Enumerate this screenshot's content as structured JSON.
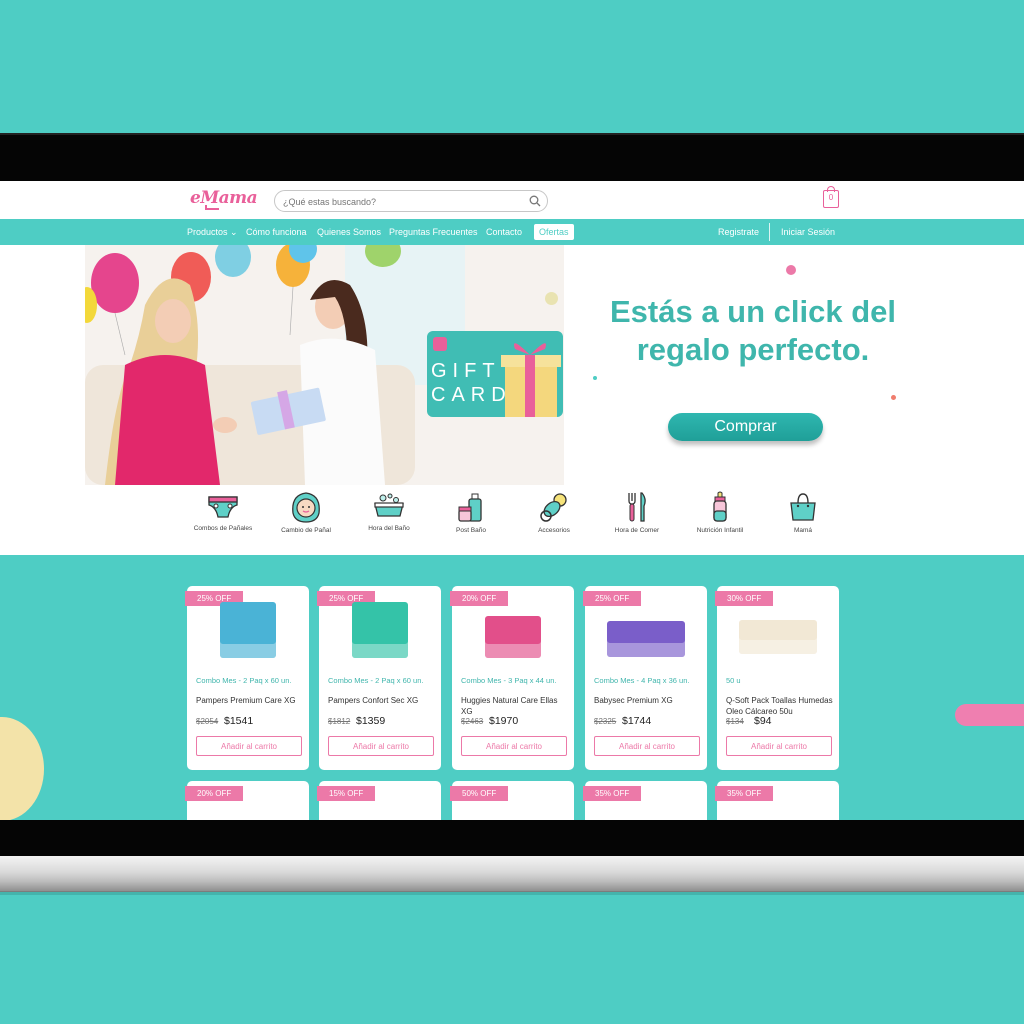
{
  "header": {
    "logo": "eMama",
    "search_placeholder": "¿Qué estas buscando?",
    "cart_count": "0"
  },
  "nav": {
    "items": [
      "Productos",
      "Cómo funciona",
      "Quienes Somos",
      "Preguntas Frecuentes",
      "Contacto"
    ],
    "ofertas": "Ofertas",
    "register": "Registrate",
    "login": "Iniciar Sesión"
  },
  "hero": {
    "title_line1": "Estás a un click del",
    "title_line2": "regalo perfecto.",
    "button": "Comprar",
    "gift_card_text_1": "GIFT",
    "gift_card_text_2": "CARD"
  },
  "categories": [
    {
      "label": "Combos de Pañales",
      "icon": "diaper-icon"
    },
    {
      "label": "Cambio de Pañal",
      "icon": "baby-face-icon"
    },
    {
      "label": "Hora del Baño",
      "icon": "bathtub-icon"
    },
    {
      "label": "Post Baño",
      "icon": "lotion-icon"
    },
    {
      "label": "Accesorios",
      "icon": "pacifier-icon"
    },
    {
      "label": "Hora de Comer",
      "icon": "cutlery-icon"
    },
    {
      "label": "Nutrición Infantil",
      "icon": "baby-bottle-icon"
    },
    {
      "label": "Mamá",
      "icon": "handbag-icon"
    }
  ],
  "products": [
    {
      "badge": "25% OFF",
      "combo": "Combo Mes - 2 Paq x 60 un.",
      "name": "Pampers Premium Care XG",
      "old_price": "$2054",
      "price": "$1541",
      "button": "Añadir al carrito",
      "color": "#4ab3d6"
    },
    {
      "badge": "25% OFF",
      "combo": "Combo Mes - 2 Paq x 60 un.",
      "name": "Pampers Confort Sec XG",
      "old_price": "$1812",
      "price": "$1359",
      "button": "Añadir al carrito",
      "color": "#34c3a8"
    },
    {
      "badge": "20% OFF",
      "combo": "Combo Mes - 3 Paq x 44 un.",
      "name": "Huggies Natural Care Ellas XG",
      "old_price": "$2463",
      "price": "$1970",
      "button": "Añadir al carrito",
      "color": "#e24f8a"
    },
    {
      "badge": "25% OFF",
      "combo": "Combo Mes - 4 Paq x 36 un.",
      "name": "Babysec Premium XG",
      "old_price": "$2325",
      "price": "$1744",
      "button": "Añadir al carrito",
      "color": "#7a5ec9"
    },
    {
      "badge": "30% OFF",
      "combo": "50 u",
      "name": "Q-Soft Pack Toallas Humedas Oleo Cálcareo 50u",
      "old_price": "$134",
      "price": "$94",
      "button": "Añadir al carrito",
      "color": "#f2e8d5"
    }
  ],
  "products_row2": [
    {
      "badge": "20% OFF"
    },
    {
      "badge": "15% OFF"
    },
    {
      "badge": "50% OFF"
    },
    {
      "badge": "35% OFF"
    },
    {
      "badge": "35% OFF"
    }
  ]
}
